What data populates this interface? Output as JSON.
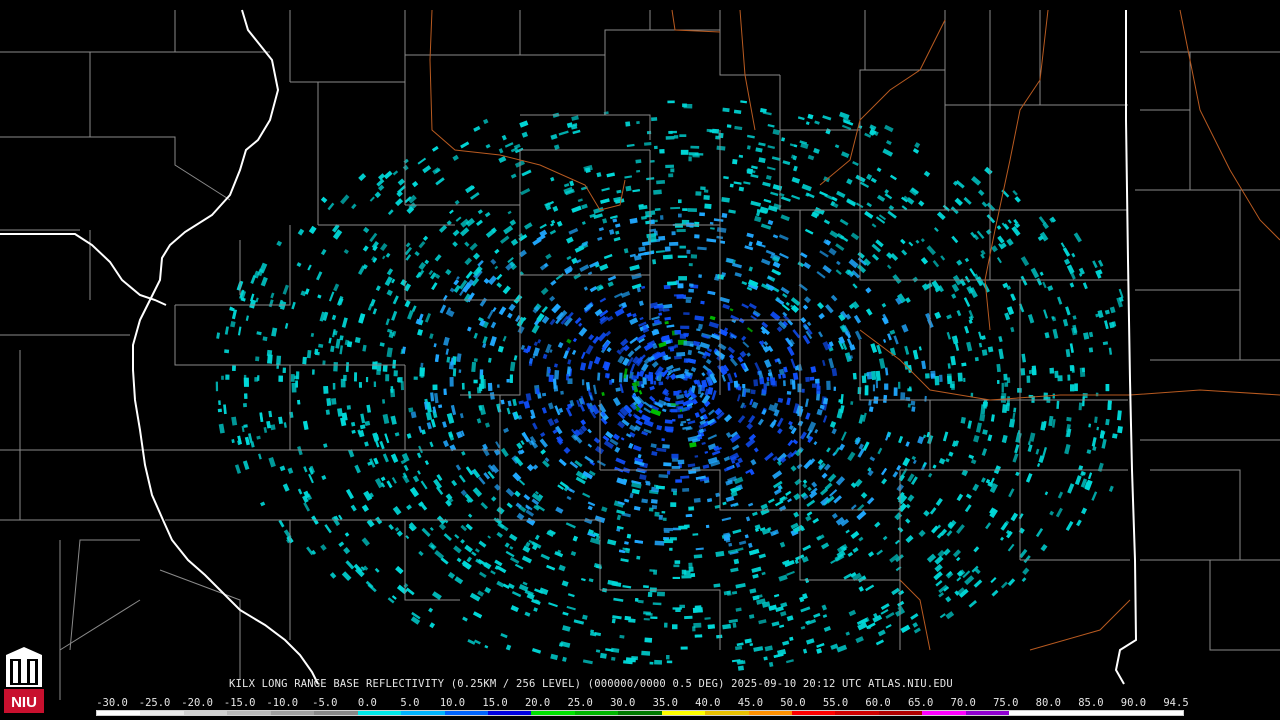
{
  "product": {
    "caption": "KILX LONG RANGE BASE REFLECTIVITY (0.25KM / 256 LEVEL) (000000/0000 0.5 DEG) 2025-09-10 20:12 UTC  ATLAS.NIU.EDU",
    "radar_site": "KILX",
    "elevation_deg": "0.5 DEG",
    "timestamp": "2025-09-10 20:12 UTC",
    "source": "ATLAS.NIU.EDU"
  },
  "logo": {
    "text": "NIU",
    "icon": "niu-tower-logo-icon",
    "color": "#c8102e"
  },
  "color_scale": {
    "labels": [
      "-30.0",
      "-25.0",
      "-20.0",
      "-15.0",
      "-10.0",
      "-5.0",
      "0.0",
      "5.0",
      "10.0",
      "15.0",
      "20.0",
      "25.0",
      "30.0",
      "35.0",
      "40.0",
      "45.0",
      "50.0",
      "55.0",
      "60.0",
      "65.0",
      "70.0",
      "75.0",
      "80.0",
      "85.0",
      "90.0",
      "94.5"
    ],
    "colors": [
      "#ffffff",
      "#e8e8e8",
      "#d0d0d0",
      "#b8b8b8",
      "#a0a0a0",
      "#888888",
      "#00e8e8",
      "#00b4ff",
      "#0064ff",
      "#0000e0",
      "#00e000",
      "#00b400",
      "#007800",
      "#ffff00",
      "#e8c000",
      "#ff9000",
      "#ff0000",
      "#d00000",
      "#b00000",
      "#ff00ff",
      "#9000d0",
      "#ffffff",
      "#ffffff",
      "#ffffff",
      "#ffffff"
    ]
  },
  "colors": {
    "county_lines": "#8a8a8a",
    "state_lines": "#ffffff",
    "rivers": "#b85a20",
    "echo_light": "#00d8d8",
    "echo_mid": "#20a8ff",
    "echo_strong": "#1050ff",
    "echo_green": "#00c000"
  }
}
